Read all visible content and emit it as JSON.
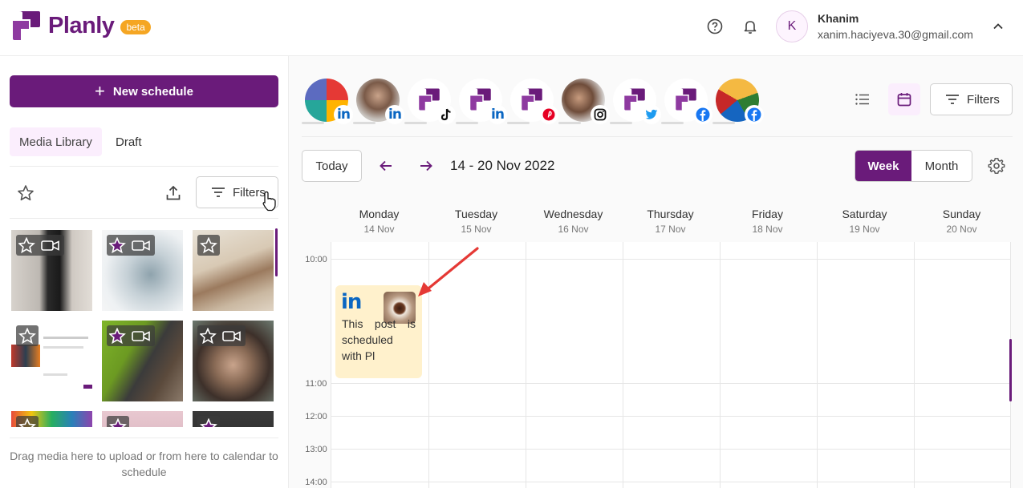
{
  "brand": {
    "name": "Planly",
    "badge": "beta",
    "accent": "#6a1b7a"
  },
  "header": {
    "user_initial": "K",
    "user_name": "Khanim",
    "user_email": "xanim.haciyeva.30@gmail.com",
    "icons": [
      "help-icon",
      "bell-icon",
      "chevron-up-icon"
    ]
  },
  "sidebar": {
    "new_schedule_label": "New schedule",
    "tabs": [
      {
        "label": "Media Library",
        "active": true
      },
      {
        "label": "Draft",
        "active": false
      }
    ],
    "filters_label": "Filters",
    "drag_hint": "Drag media here to upload or from here to calendar to schedule",
    "media": [
      {
        "type": "video",
        "starred": false
      },
      {
        "type": "video",
        "starred": true
      },
      {
        "type": "image",
        "starred": false
      },
      {
        "type": "image",
        "starred": false
      },
      {
        "type": "video",
        "starred": true
      },
      {
        "type": "video",
        "starred": false
      },
      {
        "type": "image",
        "starred": false
      },
      {
        "type": "image",
        "starred": true
      },
      {
        "type": "image",
        "starred": true
      }
    ]
  },
  "accounts": [
    {
      "network": "linkedin",
      "color": "#0a66c2"
    },
    {
      "network": "linkedin",
      "color": "#0a66c2"
    },
    {
      "network": "tiktok",
      "color": "#000000"
    },
    {
      "network": "linkedin",
      "color": "#0a66c2"
    },
    {
      "network": "pinterest",
      "color": "#e60023"
    },
    {
      "network": "instagram",
      "color": "#000000"
    },
    {
      "network": "twitter",
      "color": "#1d9bf0"
    },
    {
      "network": "facebook",
      "color": "#1877f2"
    },
    {
      "network": "facebook",
      "color": "#1877f2"
    }
  ],
  "calendar": {
    "filters_label": "Filters",
    "today_label": "Today",
    "range": "14 - 20 Nov 2022",
    "view_week": "Week",
    "view_month": "Month",
    "days": [
      {
        "name": "Monday",
        "date": "14 Nov"
      },
      {
        "name": "Tuesday",
        "date": "15 Nov"
      },
      {
        "name": "Wednesday",
        "date": "16 Nov"
      },
      {
        "name": "Thursday",
        "date": "17 Nov"
      },
      {
        "name": "Friday",
        "date": "18 Nov"
      },
      {
        "name": "Saturday",
        "date": "19 Nov"
      },
      {
        "name": "Sunday",
        "date": "20 Nov"
      }
    ],
    "times": [
      "10:00",
      "11:00",
      "12:00",
      "13:00",
      "14:00"
    ],
    "event": {
      "network_label": "in",
      "text": "This post is scheduled with Pl"
    }
  }
}
